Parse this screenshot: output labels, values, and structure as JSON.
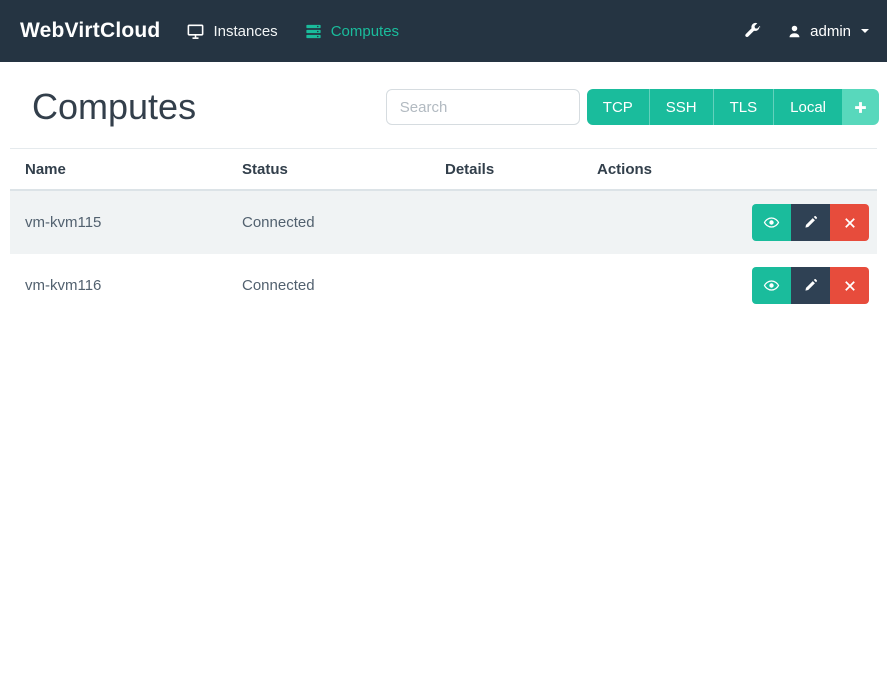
{
  "navbar": {
    "brand": "WebVirtCloud",
    "items": [
      {
        "label": "Instances",
        "icon": "monitor-icon",
        "active": false
      },
      {
        "label": "Computes",
        "icon": "server-icon",
        "active": true
      }
    ],
    "tools": {
      "wrench": "wrench-icon"
    },
    "user": {
      "name": "admin",
      "icon": "user-icon",
      "caret": "caret-down-icon"
    }
  },
  "page": {
    "title": "Computes"
  },
  "search": {
    "placeholder": "Search"
  },
  "toolbar": {
    "protocols": [
      "TCP",
      "SSH",
      "TLS",
      "Local"
    ],
    "add_icon": "plus-icon"
  },
  "table": {
    "headers": [
      "Name",
      "Status",
      "Details",
      "Actions"
    ],
    "rows": [
      {
        "name": "vm-kvm115",
        "status": "Connected",
        "details": ""
      },
      {
        "name": "vm-kvm116",
        "status": "Connected",
        "details": ""
      }
    ],
    "row_action_icons": [
      "eye-icon",
      "pencil-icon",
      "x-icon"
    ]
  },
  "colors": {
    "navbar_bg": "#253442",
    "accent_teal": "#1abc9c",
    "accent_teal_light": "#58d8bc",
    "dark_button": "#2f4154",
    "danger": "#e74c3c",
    "stripe": "#f0f3f4"
  }
}
